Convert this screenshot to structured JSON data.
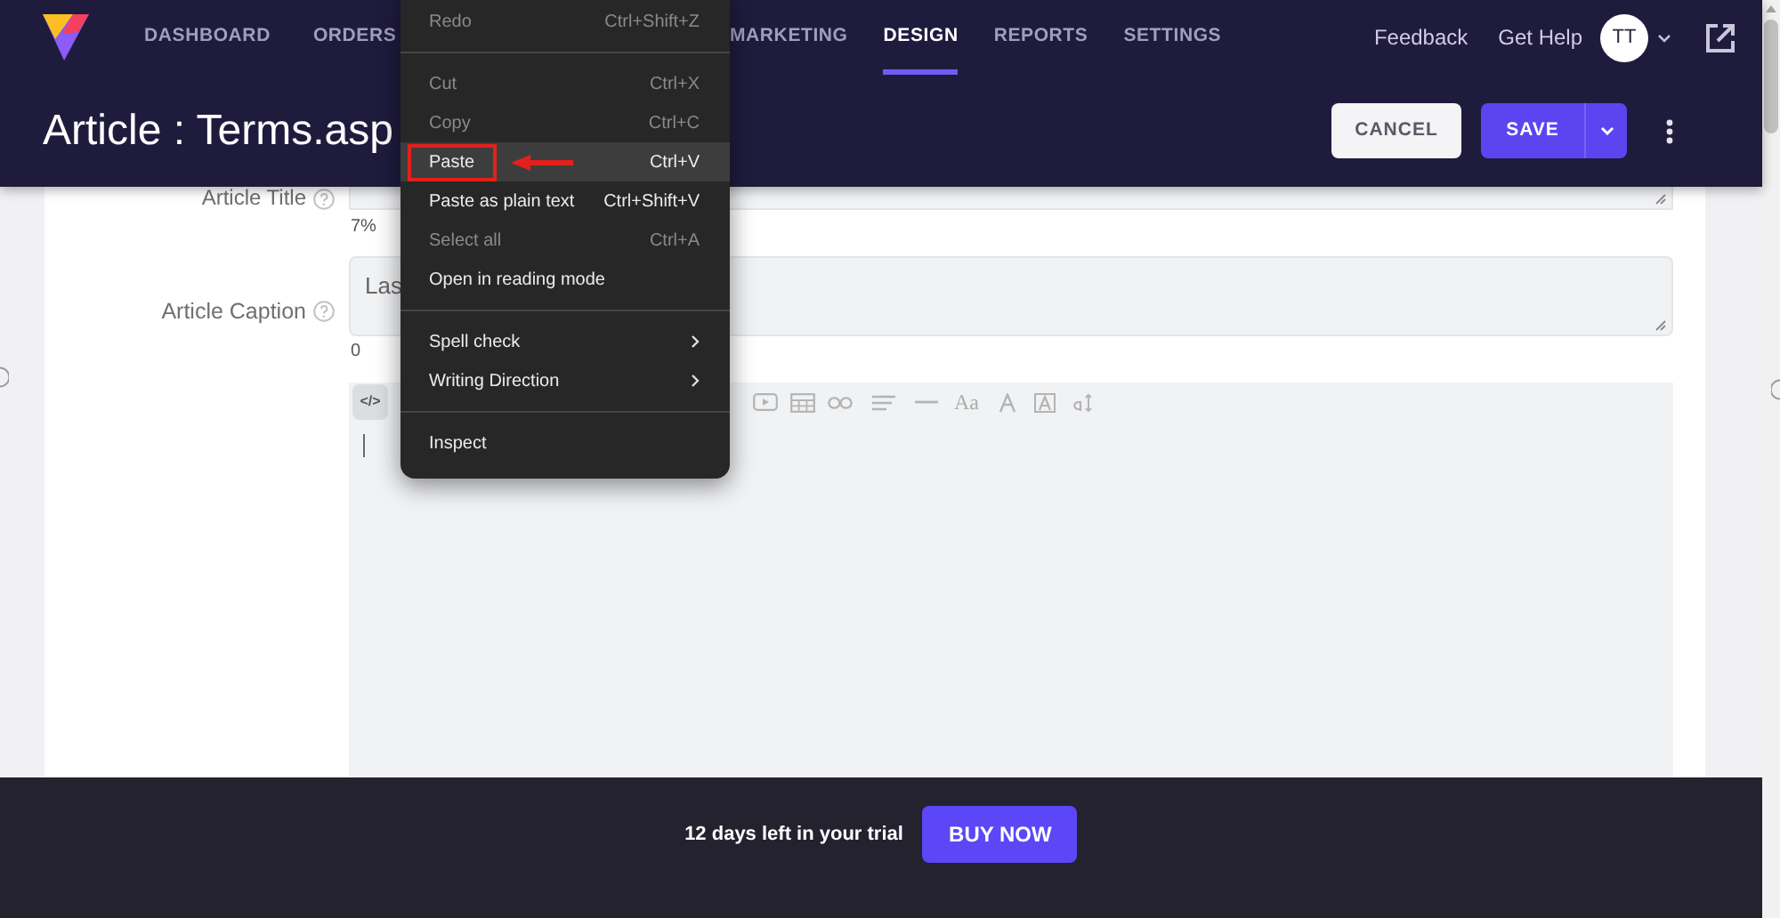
{
  "header": {
    "nav_items": [
      {
        "label": "DASHBOARD",
        "selected": false
      },
      {
        "label": "ORDERS",
        "selected": false
      },
      {
        "label": "MARKETING",
        "selected": false
      },
      {
        "label": "DESIGN",
        "selected": true
      },
      {
        "label": "REPORTS",
        "selected": false
      },
      {
        "label": "SETTINGS",
        "selected": false
      }
    ],
    "links": [
      "Feedback",
      "Get Help"
    ],
    "avatar_initials": "TT"
  },
  "page_header": {
    "title": "Article : Terms.asp",
    "cancel_button": "CANCEL",
    "save_button": "SAVE"
  },
  "form": {
    "title_field": {
      "label": "Article Title",
      "counter": "7%"
    },
    "caption_field": {
      "label": "Article Caption",
      "value": "Las",
      "counter": "0"
    },
    "editor": {
      "code_button": "</>",
      "font_size_button": "Aa"
    }
  },
  "trial_banner": {
    "text": "12 days left in your trial",
    "button": "BUY NOW"
  },
  "context_menu": {
    "items": [
      {
        "kind": "item",
        "label": "Redo",
        "shortcut": "Ctrl+Shift+Z",
        "disabled": true,
        "selected": false,
        "submenu": false,
        "annotated": false
      },
      {
        "kind": "separator"
      },
      {
        "kind": "item",
        "label": "Cut",
        "shortcut": "Ctrl+X",
        "disabled": true,
        "selected": false,
        "submenu": false,
        "annotated": false
      },
      {
        "kind": "item",
        "label": "Copy",
        "shortcut": "Ctrl+C",
        "disabled": true,
        "selected": false,
        "submenu": false,
        "annotated": false
      },
      {
        "kind": "item",
        "label": "Paste",
        "shortcut": "Ctrl+V",
        "disabled": false,
        "selected": true,
        "submenu": false,
        "annotated": true
      },
      {
        "kind": "item",
        "label": "Paste as plain text",
        "shortcut": "Ctrl+Shift+V",
        "disabled": false,
        "selected": false,
        "submenu": false,
        "annotated": false
      },
      {
        "kind": "item",
        "label": "Select all",
        "shortcut": "Ctrl+A",
        "disabled": true,
        "selected": false,
        "submenu": false,
        "annotated": false
      },
      {
        "kind": "item",
        "label": "Open in reading mode",
        "disabled": false,
        "selected": false,
        "submenu": false,
        "annotated": false
      },
      {
        "kind": "separator"
      },
      {
        "kind": "item",
        "label": "Spell check",
        "disabled": false,
        "selected": false,
        "submenu": true,
        "annotated": false
      },
      {
        "kind": "item",
        "label": "Writing Direction",
        "disabled": false,
        "selected": false,
        "submenu": true,
        "annotated": false
      },
      {
        "kind": "separator"
      },
      {
        "kind": "item",
        "label": "Inspect",
        "disabled": false,
        "selected": false,
        "submenu": false,
        "annotated": false
      }
    ]
  }
}
